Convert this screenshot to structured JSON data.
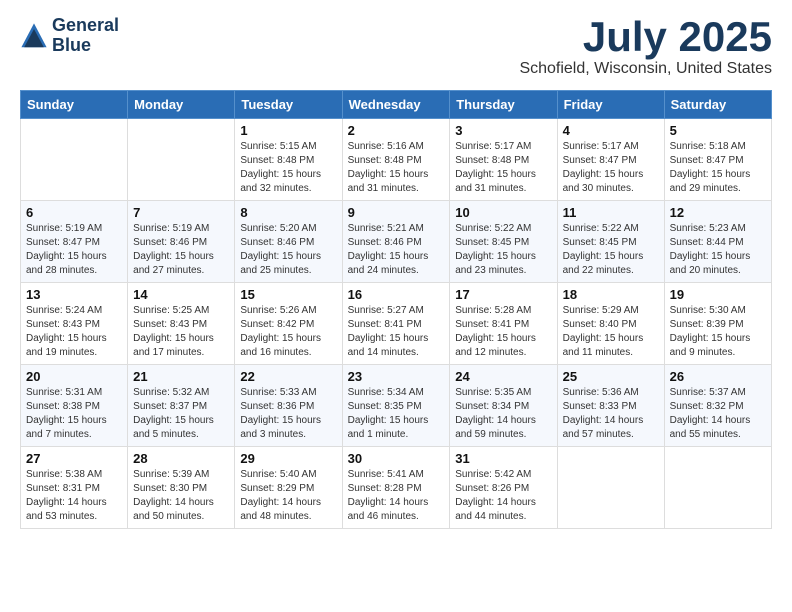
{
  "header": {
    "logo_line1": "General",
    "logo_line2": "Blue",
    "month_year": "July 2025",
    "location": "Schofield, Wisconsin, United States"
  },
  "weekdays": [
    "Sunday",
    "Monday",
    "Tuesday",
    "Wednesday",
    "Thursday",
    "Friday",
    "Saturday"
  ],
  "weeks": [
    [
      {
        "day": "",
        "info": ""
      },
      {
        "day": "",
        "info": ""
      },
      {
        "day": "1",
        "info": "Sunrise: 5:15 AM\nSunset: 8:48 PM\nDaylight: 15 hours and 32 minutes."
      },
      {
        "day": "2",
        "info": "Sunrise: 5:16 AM\nSunset: 8:48 PM\nDaylight: 15 hours and 31 minutes."
      },
      {
        "day": "3",
        "info": "Sunrise: 5:17 AM\nSunset: 8:48 PM\nDaylight: 15 hours and 31 minutes."
      },
      {
        "day": "4",
        "info": "Sunrise: 5:17 AM\nSunset: 8:47 PM\nDaylight: 15 hours and 30 minutes."
      },
      {
        "day": "5",
        "info": "Sunrise: 5:18 AM\nSunset: 8:47 PM\nDaylight: 15 hours and 29 minutes."
      }
    ],
    [
      {
        "day": "6",
        "info": "Sunrise: 5:19 AM\nSunset: 8:47 PM\nDaylight: 15 hours and 28 minutes."
      },
      {
        "day": "7",
        "info": "Sunrise: 5:19 AM\nSunset: 8:46 PM\nDaylight: 15 hours and 27 minutes."
      },
      {
        "day": "8",
        "info": "Sunrise: 5:20 AM\nSunset: 8:46 PM\nDaylight: 15 hours and 25 minutes."
      },
      {
        "day": "9",
        "info": "Sunrise: 5:21 AM\nSunset: 8:46 PM\nDaylight: 15 hours and 24 minutes."
      },
      {
        "day": "10",
        "info": "Sunrise: 5:22 AM\nSunset: 8:45 PM\nDaylight: 15 hours and 23 minutes."
      },
      {
        "day": "11",
        "info": "Sunrise: 5:22 AM\nSunset: 8:45 PM\nDaylight: 15 hours and 22 minutes."
      },
      {
        "day": "12",
        "info": "Sunrise: 5:23 AM\nSunset: 8:44 PM\nDaylight: 15 hours and 20 minutes."
      }
    ],
    [
      {
        "day": "13",
        "info": "Sunrise: 5:24 AM\nSunset: 8:43 PM\nDaylight: 15 hours and 19 minutes."
      },
      {
        "day": "14",
        "info": "Sunrise: 5:25 AM\nSunset: 8:43 PM\nDaylight: 15 hours and 17 minutes."
      },
      {
        "day": "15",
        "info": "Sunrise: 5:26 AM\nSunset: 8:42 PM\nDaylight: 15 hours and 16 minutes."
      },
      {
        "day": "16",
        "info": "Sunrise: 5:27 AM\nSunset: 8:41 PM\nDaylight: 15 hours and 14 minutes."
      },
      {
        "day": "17",
        "info": "Sunrise: 5:28 AM\nSunset: 8:41 PM\nDaylight: 15 hours and 12 minutes."
      },
      {
        "day": "18",
        "info": "Sunrise: 5:29 AM\nSunset: 8:40 PM\nDaylight: 15 hours and 11 minutes."
      },
      {
        "day": "19",
        "info": "Sunrise: 5:30 AM\nSunset: 8:39 PM\nDaylight: 15 hours and 9 minutes."
      }
    ],
    [
      {
        "day": "20",
        "info": "Sunrise: 5:31 AM\nSunset: 8:38 PM\nDaylight: 15 hours and 7 minutes."
      },
      {
        "day": "21",
        "info": "Sunrise: 5:32 AM\nSunset: 8:37 PM\nDaylight: 15 hours and 5 minutes."
      },
      {
        "day": "22",
        "info": "Sunrise: 5:33 AM\nSunset: 8:36 PM\nDaylight: 15 hours and 3 minutes."
      },
      {
        "day": "23",
        "info": "Sunrise: 5:34 AM\nSunset: 8:35 PM\nDaylight: 15 hours and 1 minute."
      },
      {
        "day": "24",
        "info": "Sunrise: 5:35 AM\nSunset: 8:34 PM\nDaylight: 14 hours and 59 minutes."
      },
      {
        "day": "25",
        "info": "Sunrise: 5:36 AM\nSunset: 8:33 PM\nDaylight: 14 hours and 57 minutes."
      },
      {
        "day": "26",
        "info": "Sunrise: 5:37 AM\nSunset: 8:32 PM\nDaylight: 14 hours and 55 minutes."
      }
    ],
    [
      {
        "day": "27",
        "info": "Sunrise: 5:38 AM\nSunset: 8:31 PM\nDaylight: 14 hours and 53 minutes."
      },
      {
        "day": "28",
        "info": "Sunrise: 5:39 AM\nSunset: 8:30 PM\nDaylight: 14 hours and 50 minutes."
      },
      {
        "day": "29",
        "info": "Sunrise: 5:40 AM\nSunset: 8:29 PM\nDaylight: 14 hours and 48 minutes."
      },
      {
        "day": "30",
        "info": "Sunrise: 5:41 AM\nSunset: 8:28 PM\nDaylight: 14 hours and 46 minutes."
      },
      {
        "day": "31",
        "info": "Sunrise: 5:42 AM\nSunset: 8:26 PM\nDaylight: 14 hours and 44 minutes."
      },
      {
        "day": "",
        "info": ""
      },
      {
        "day": "",
        "info": ""
      }
    ]
  ]
}
